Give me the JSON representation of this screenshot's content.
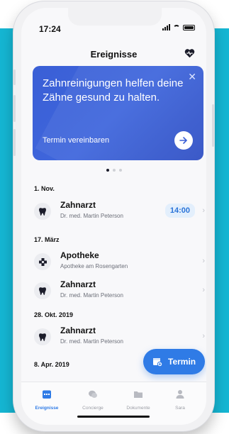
{
  "status": {
    "time": "17:24"
  },
  "header": {
    "title": "Ereignisse"
  },
  "banner": {
    "text": "Zahnreinigungen helfen deine Zähne gesund zu halten.",
    "close_glyph": "✕",
    "link": "Termin vereinbaren"
  },
  "pager": {
    "count": 3,
    "active": 0
  },
  "events": [
    {
      "date": "1. Nov.",
      "items": [
        {
          "title": "Zahnarzt",
          "subtitle": "Dr. med. Martin Peterson",
          "time": "14:00",
          "icon": "tooth-icon"
        }
      ]
    },
    {
      "date": "17. März",
      "items": [
        {
          "title": "Apotheke",
          "subtitle": "Apotheke am Rosengarten",
          "icon": "pharmacy-icon"
        },
        {
          "title": "Zahnarzt",
          "subtitle": "Dr. med. Martin Peterson",
          "icon": "tooth-icon"
        }
      ]
    },
    {
      "date": "28. Okt. 2019",
      "items": [
        {
          "title": "Zahnarzt",
          "subtitle": "Dr. med. Martin Peterson",
          "icon": "tooth-icon"
        }
      ]
    },
    {
      "date": "8. Apr. 2019",
      "items": []
    }
  ],
  "fab": {
    "label": "Termin",
    "icon": "calendar-add-icon"
  },
  "tabbar": {
    "tabs": [
      {
        "label": "Ereignisse",
        "icon": "calendar-icon",
        "active": true
      },
      {
        "label": "Concierge",
        "icon": "chat-icon",
        "active": false
      },
      {
        "label": "Dokumente",
        "icon": "folder-icon",
        "active": false
      },
      {
        "label": "Sara",
        "icon": "person-icon",
        "active": false
      }
    ]
  },
  "colors": {
    "accent": "#2f7be6",
    "banner": "#3a5fd6",
    "background": "#15b6d3"
  }
}
